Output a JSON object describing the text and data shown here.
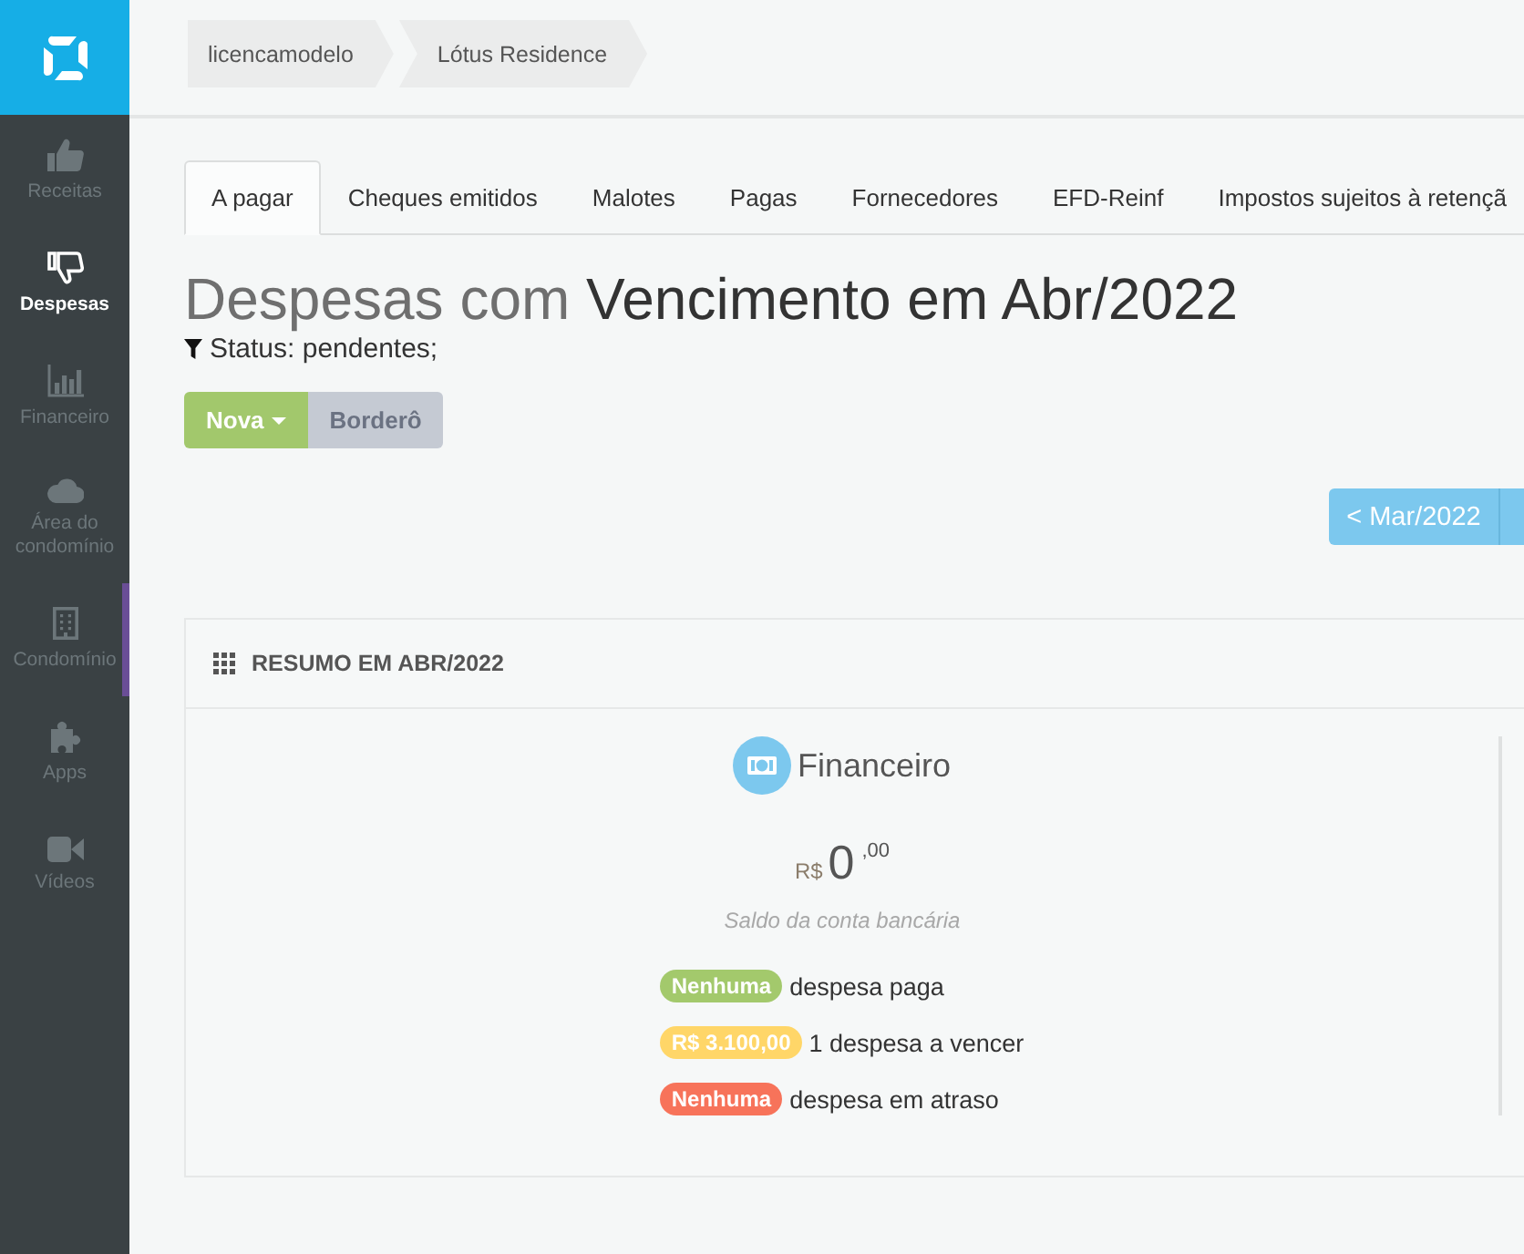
{
  "sidebar": {
    "items": [
      {
        "label": "Receitas",
        "selected": false,
        "hovered": false
      },
      {
        "label": "Despesas",
        "selected": true,
        "hovered": false
      },
      {
        "label": "Financeiro",
        "selected": false,
        "hovered": false
      },
      {
        "label": "Área do condomínio",
        "selected": false,
        "hovered": false
      },
      {
        "label": "Condomínio",
        "selected": false,
        "hovered": true
      },
      {
        "label": "Apps",
        "selected": false,
        "hovered": false
      },
      {
        "label": "Vídeos",
        "selected": false,
        "hovered": false
      }
    ]
  },
  "breadcrumbs": [
    "licencamodelo",
    "Lótus Residence"
  ],
  "tabs": [
    {
      "label": "A pagar",
      "selected": true
    },
    {
      "label": "Cheques emitidos",
      "selected": false
    },
    {
      "label": "Malotes",
      "selected": false
    },
    {
      "label": "Pagas",
      "selected": false
    },
    {
      "label": "Fornecedores",
      "selected": false
    },
    {
      "label": "EFD-Reinf",
      "selected": false
    },
    {
      "label": "Impostos sujeitos à retençã",
      "selected": false
    }
  ],
  "title": {
    "muted": "Despesas com",
    "main": "Vencimento em Abr/2022"
  },
  "filter": {
    "text": "Status: pendentes;"
  },
  "actions": [
    {
      "label": "Nova",
      "kind": "dropdown",
      "disabled": false
    },
    {
      "label": "Borderô",
      "kind": "plain",
      "disabled": true
    }
  ],
  "month_nav": {
    "previous": "< Mar/2022"
  },
  "summary": {
    "title": "RESUMO EM ABR/2022",
    "section": {
      "title": "Financeiro",
      "currency": "R$",
      "amount": "0",
      "cents": ",00",
      "caption": "Saldo da conta bancária"
    },
    "lines": [
      {
        "badge": "Nenhuma",
        "text": "despesa paga",
        "color": "#a3c96c"
      },
      {
        "badge": "R$ 3.100,00",
        "text": "1 despesa a vencer",
        "color": "#ffd668"
      },
      {
        "badge": "Nenhuma",
        "text": "despesa em atraso",
        "color": "#f7735a"
      }
    ]
  }
}
